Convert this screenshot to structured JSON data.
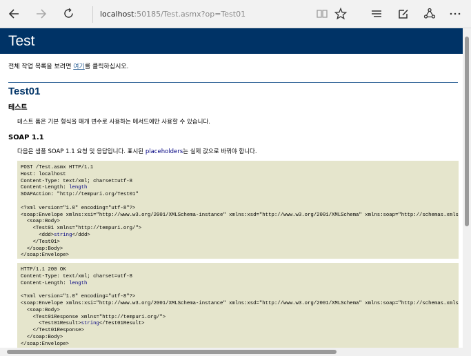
{
  "browser": {
    "url_host": "localhost",
    "url_rest": ":50185/Test.asmx?op=Test01",
    "icons": [
      "back-icon",
      "forward-icon",
      "refresh-icon",
      "reading-view-icon",
      "favorite-star-icon",
      "hub-icon",
      "web-note-icon",
      "share-icon",
      "more-icon"
    ]
  },
  "page": {
    "title": "Test",
    "intro_before": "전체 작업 목록을 보려면 ",
    "intro_link": "여기",
    "intro_after": "를 클릭하십시오.",
    "operation": "Test01",
    "section_test": "테스트",
    "test_desc": "테스트 폼은 기본 형식을 매개 변수로 사용하는 메서드에만 사용할 수 있습니다.",
    "section_soap": "SOAP 1.1",
    "soap_desc_before": "다음은 샘플 SOAP 1.1 요청 및 응답입니다. 표시된 ",
    "soap_desc_placeholder": "placeholders",
    "soap_desc_after": "는 실제 값으로 바꿔야 합니다.",
    "request": {
      "l1": "POST /Test.asmx HTTP/1.1",
      "l2": "Host: localhost",
      "l3": "Content-Type: text/xml; charset=utf-8",
      "l4a": "Content-Length: ",
      "l4b": "length",
      "l5": "SOAPAction: \"http://tempuri.org/Test01\"",
      "l6": "<?xml version=\"1.0\" encoding=\"utf-8\"?>",
      "l7": "<soap:Envelope xmlns:xsi=\"http://www.w3.org/2001/XMLSchema-instance\" xmlns:xsd=\"http://www.w3.org/2001/XMLSchema\" xmlns:soap=\"http://schemas.xmlsoap.org/soap/envelope/\">",
      "l8": "  <soap:Body>",
      "l9": "    <Test01 xmlns=\"http://tempuri.org/\">",
      "l10a": "      <ddd>",
      "l10b": "string",
      "l10c": "</ddd>",
      "l11": "    </Test01>",
      "l12": "  </soap:Body>",
      "l13": "</soap:Envelope>"
    },
    "response": {
      "l1": "HTTP/1.1 200 OK",
      "l2": "Content-Type: text/xml; charset=utf-8",
      "l3a": "Content-Length: ",
      "l3b": "length",
      "l4": "<?xml version=\"1.0\" encoding=\"utf-8\"?>",
      "l5": "<soap:Envelope xmlns:xsi=\"http://www.w3.org/2001/XMLSchema-instance\" xmlns:xsd=\"http://www.w3.org/2001/XMLSchema\" xmlns:soap=\"http://schemas.xmlsoap.org/soap/envelope/\">",
      "l6": "  <soap:Body>",
      "l7": "    <Test01Response xmlns=\"http://tempuri.org/\">",
      "l8a": "      <Test01Result>",
      "l8b": "string",
      "l8c": "</Test01Result>",
      "l9": "    </Test01Response>",
      "l10": "  </soap:Body>",
      "l11": "</soap:Envelope>"
    }
  },
  "colors": {
    "title_bar": "#003366",
    "link": "#336699",
    "code_bg": "#e5e5cc",
    "placeholder": "#000080"
  }
}
